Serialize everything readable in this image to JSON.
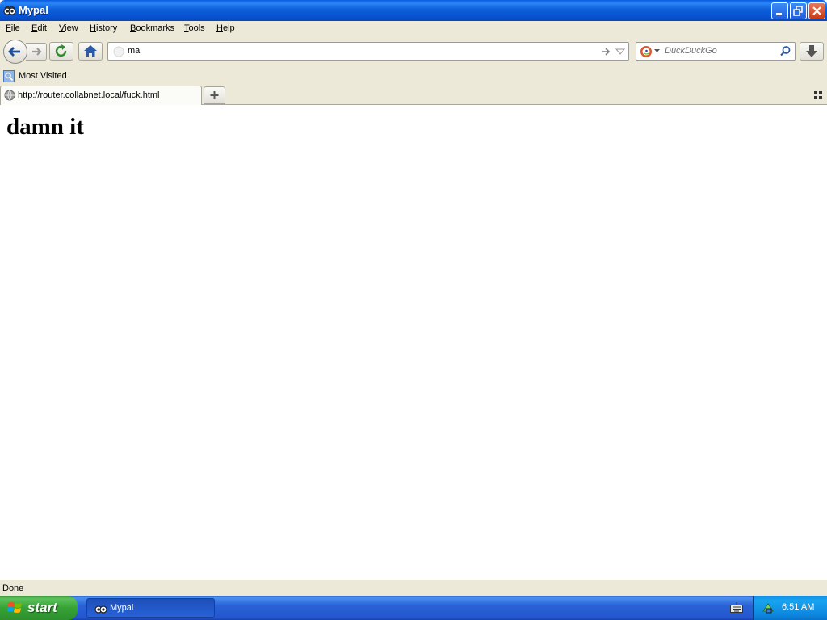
{
  "window": {
    "title": "Mypal"
  },
  "menu": {
    "items": [
      {
        "label": "File",
        "key": "F",
        "rest": "ile"
      },
      {
        "label": "Edit",
        "key": "E",
        "rest": "dit"
      },
      {
        "label": "View",
        "key": "V",
        "rest": "iew"
      },
      {
        "label": "History",
        "key": "H",
        "rest": "istory"
      },
      {
        "label": "Bookmarks",
        "key": "B",
        "rest": "ookmarks"
      },
      {
        "label": "Tools",
        "key": "T",
        "rest": "ools"
      },
      {
        "label": "Help",
        "key": "H",
        "rest": "elp"
      }
    ]
  },
  "toolbar": {
    "url_value": "ma",
    "search_placeholder": "DuckDuckGo"
  },
  "bookmarks": {
    "most_visited": "Most Visited"
  },
  "tabs": [
    {
      "label": "http://router.collabnet.local/fuck.html"
    }
  ],
  "page": {
    "heading": "damn it"
  },
  "status": {
    "text": "Done"
  },
  "taskbar": {
    "start_label": "start",
    "task_label": "Mypal",
    "clock": "6:51 AM"
  },
  "colors": {
    "titlebar": "#0752d2",
    "chrome": "#ece9d8",
    "taskbar": "#2456cf",
    "start": "#36a336",
    "tray": "#0d86df"
  }
}
